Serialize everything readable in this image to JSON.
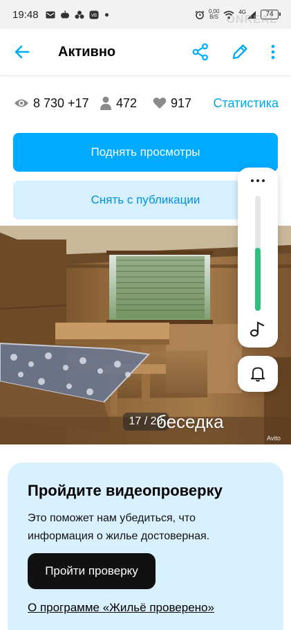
{
  "status_bar": {
    "time": "19:48",
    "net_speed": "0,00",
    "net_unit": "B/S",
    "network": "4G",
    "battery": "74",
    "watermark": "ONREAL"
  },
  "header": {
    "title": "Активно",
    "icons": [
      "back-arrow-icon",
      "share-icon",
      "edit-pencil-icon",
      "more-vertical-icon"
    ],
    "accent_color": "#00aaff"
  },
  "stats": {
    "views": "8 730 +17",
    "users": "472",
    "likes": "917",
    "link": "Статистика"
  },
  "actions": {
    "primary_label": "Поднять просмотры",
    "secondary_label": "Снять с публикации"
  },
  "photo": {
    "counter": "17 / 20",
    "caption": "беседка",
    "brand": "Avito"
  },
  "overlay": {
    "volume_level": 0.55,
    "volume_color": "#2ec27e",
    "icons": [
      "more-horizontal-icon",
      "music-note-icon",
      "bell-icon"
    ]
  },
  "verification": {
    "title": "Пройдите видеопроверку",
    "text": "Это поможет нам убедиться, что информация о жилье достоверная.",
    "button": "Пройти проверку",
    "link": "О программе «Жильё проверено»"
  }
}
